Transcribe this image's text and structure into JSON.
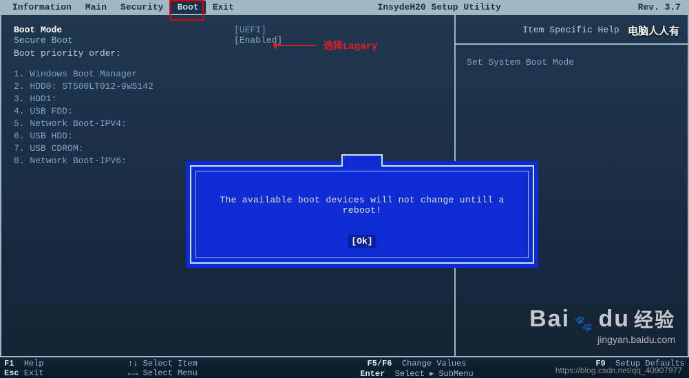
{
  "topbar": {
    "tabs": [
      "Information",
      "Main",
      "Security",
      "Boot",
      "Exit"
    ],
    "active_index": 3,
    "title": "InsydeH20 Setup Utility",
    "rev": "Rev. 3.7"
  },
  "left": {
    "boot_mode_label": "Boot Mode",
    "boot_mode_value": "[UEFI]",
    "secure_boot_label": "Secure Boot",
    "secure_boot_value": "[Enabled]",
    "priority_title": "Boot priority order:",
    "items": [
      "1.  Windows Boot Manager",
      "2.  HDD0: ST500LT012-9WS142",
      "3.  HDD1:",
      "4.  USB FDD:",
      "5.  Network Boot-IPV4:",
      "6.  USB HDD:",
      "7.  USB CDROM:",
      "8.  Network Boot-IPV6:"
    ]
  },
  "right": {
    "title": "Item Specific Help",
    "body": "Set System Boot Mode"
  },
  "annotation": {
    "text": "选择Lagary"
  },
  "modal": {
    "message": "The available boot devices will not change untill a reboot!",
    "ok": "[Ok]"
  },
  "footer": {
    "f1": "F1",
    "f1t": "Help",
    "esc": "Esc",
    "esct": "Exit",
    "ud": "↑↓",
    "udt": "Select Item",
    "lr": "←→",
    "lrt": "Select Menu",
    "f56": "F5/F6",
    "f56t": "Change Values",
    "ent": "Enter",
    "entt": "Select ▸ SubMenu",
    "f9": "F9",
    "f9t": "Setup Defaults"
  },
  "watermarks": {
    "top": "电脑人人有",
    "baidu_en": "Bai",
    "baidu_du": "du",
    "baidu_cn": "经验",
    "baidu_url": "jingyan.baidu.com",
    "csdn": "https://blog.csdn.net/qq_40907977"
  }
}
